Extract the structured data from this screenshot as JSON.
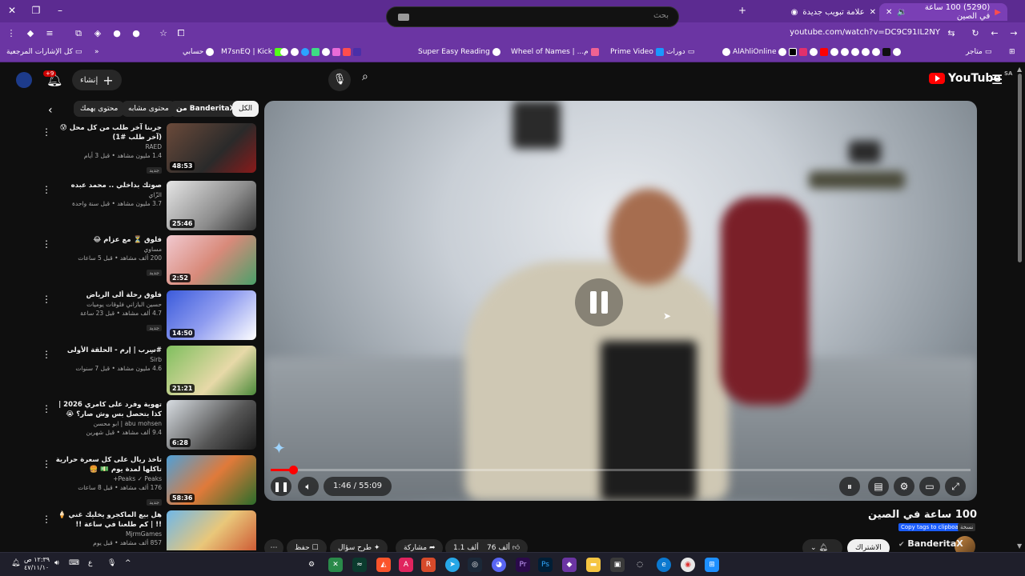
{
  "browser": {
    "tabs": [
      {
        "label": "(5290) 100 ساعة في الصين",
        "active": true
      },
      {
        "label": "علامة تبويب جديدة",
        "active": false
      }
    ],
    "url": "youtube.com/watch?v=DC9C91IL2NY",
    "bookmarks_folder_left": "كل الإشارات المرجعية",
    "bookmarks": [
      "حسابي",
      "M7snEQ | Kick",
      "Super Easy Reading",
      "Wheel of Names | ...م",
      "Prime Video",
      "دورات",
      "AlAhliOnline",
      "متاجر"
    ]
  },
  "masthead": {
    "create_label": "إنشاء",
    "notifications_count": "+9",
    "search_placeholder": "بحث",
    "logo_text": "YouTube",
    "country_code": "SA"
  },
  "chips": [
    "الكل",
    "من BanderitaX",
    "محتوى مشابه",
    "محتوى يهمك"
  ],
  "recommendations": [
    {
      "title": "جربنا آخر طلب من كل محل 😰 (آخر طلب #1)",
      "channel": "RAED",
      "views": "1.4 مليون مشاهد • قبل 3 أيام",
      "badge": "جديد",
      "duration": "48:53"
    },
    {
      "title": "صوتك بداخلي .. محمد عبده",
      "channel": "الزّاي",
      "views": "3.7 مليون مشاهد • قبل سنة واحدة",
      "badge": "",
      "duration": "25:46"
    },
    {
      "title": "فلوق ⏳ مع عزام 😂",
      "channel": "مساوي",
      "views": "200 ألف مشاهد • قبل 5 ساعات",
      "badge": "جديد",
      "duration": "2:52"
    },
    {
      "title": "فلوق رحلة ألى الرياض",
      "channel": "حسين البازاني فلوقات يوميات",
      "views": "4.7 ألف مشاهد • قبل 23 ساعة",
      "badge": "جديد",
      "duration": "14:50"
    },
    {
      "title": "#سِرب | إرم - الحلقة الأولى",
      "channel": "Sirb",
      "views": "4.6 مليون مشاهد • قبل 7 سنوات",
      "badge": "",
      "duration": "21:21"
    },
    {
      "title": "تهوية وفرد على كامري 2026 | كذا بتحصل بس وش صار؟ 😭",
      "channel": "abu mohsen | ابو محسن",
      "views": "9.4 ألف مشاهد • قبل شهرين",
      "badge": "",
      "duration": "6:28"
    },
    {
      "title": "تاخذ ريال على كل سعرة حرارية تاكلها لمدة يوم 💵 🍔",
      "channel": "Peaks ✓ Peaks+",
      "views": "176 ألف مشاهد • قبل 8 ساعات",
      "badge": "جديد",
      "duration": "58:36"
    },
    {
      "title": "هل بيع الماكجرو يخليك غني 🍦 !! | كم طلعنا في ساعة !!",
      "channel": "MjrmGames",
      "views": "857 ألف مشاهد • قبل يوم",
      "badge": "",
      "duration": ""
    }
  ],
  "player": {
    "time_label": "1:46 / 55:09",
    "progress": 0.032
  },
  "video": {
    "title": "100 ساعة في الصين",
    "tag_label": "Copy tags to clipboard",
    "tag_label2": "نسخة",
    "channel": "BanderitaX",
    "subscribe_label": "الاشتراك",
    "likes": "76 ألف",
    "dislikes": "1.1 ألف",
    "share_label": "مشاركة",
    "ask_label": "طرح سؤال",
    "save_label": "حفظ"
  },
  "taskbar": {
    "time": "١٢:٣٩ ص",
    "date": "٤٧/١١/١٠"
  },
  "colors": {
    "accent": "#ff0000",
    "browser": "#6b35a3"
  }
}
